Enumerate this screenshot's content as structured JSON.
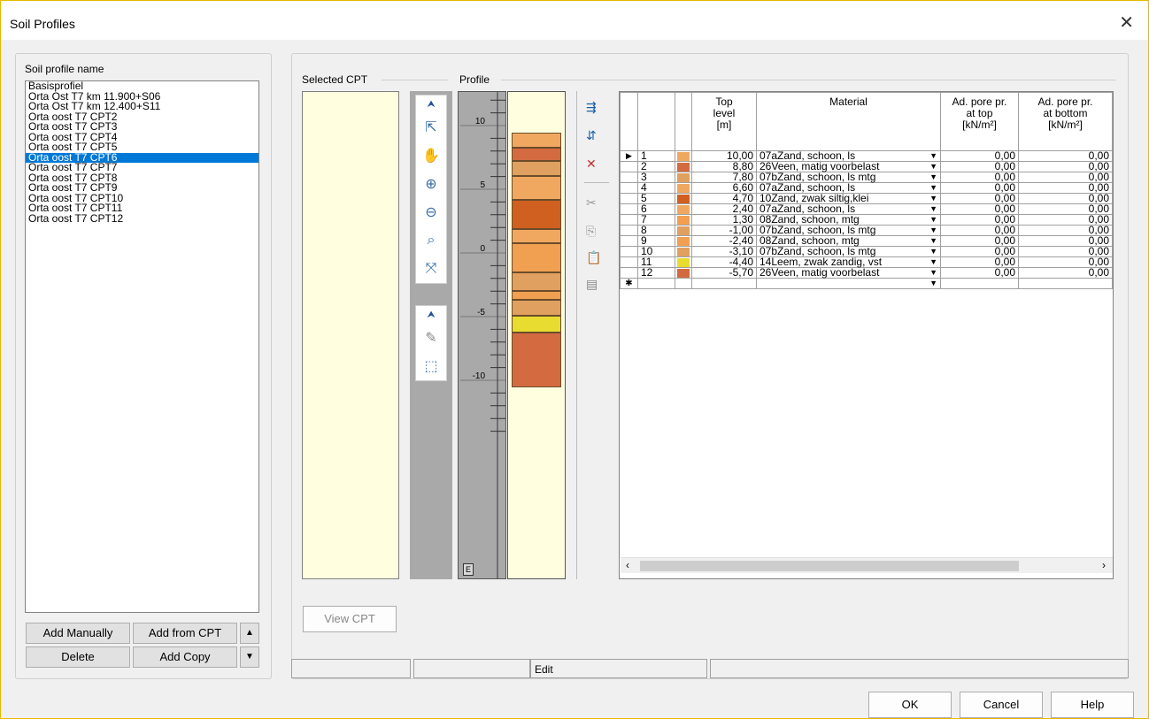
{
  "window": {
    "title": "Soil Profiles",
    "close_glyph": "✕"
  },
  "left_panel": {
    "group_label": "Soil profile name",
    "profiles": [
      "Basisprofiel",
      "Orta Ost T7 km 11.900+S06",
      "Orta Ost T7 km 12.400+S11",
      "Orta oost T7 CPT2",
      "Orta oost T7 CPT3",
      "Orta oost T7 CPT4",
      "Orta oost T7 CPT5",
      "Orta oost T7 CPT6",
      "Orta oost T7 CPT7",
      "Orta oost T7 CPT8",
      "Orta oost T7 CPT9",
      "Orta oost T7 CPT10",
      "Orta oost T7 CPT11",
      "Orta oost T7 CPT12"
    ],
    "selected_index": 7,
    "buttons": {
      "add_manually": "Add Manually",
      "add_from_cpt": "Add from CPT",
      "delete": "Delete",
      "add_copy": "Add Copy",
      "up_glyph": "▲",
      "down_glyph": "▼"
    }
  },
  "right_panel": {
    "selected_cpt_label": "Selected CPT",
    "profile_label": "Profile",
    "view_cpt_button": "View CPT",
    "ruler_ticks": [
      "10",
      "5",
      "0",
      "-5",
      "-10"
    ],
    "ruler_corner": "E",
    "status_text": "Edit"
  },
  "grid": {
    "headers": {
      "top_level": [
        "Top",
        "level",
        "[m]"
      ],
      "material": "Material",
      "pore_top": [
        "Ad. pore pr.",
        "at top",
        "[kN/m²]"
      ],
      "pore_bottom": [
        "Ad. pore pr.",
        "at bottom",
        "[kN/m²]"
      ]
    },
    "rows": [
      {
        "no": "1",
        "color": "#f0a860",
        "top": "10,00",
        "material": "07aZand, schoon, ls",
        "pt": "0,00",
        "pb": "0,00"
      },
      {
        "no": "2",
        "color": "#d46a40",
        "top": "8,80",
        "material": "26Veen, matig voorbelast",
        "pt": "0,00",
        "pb": "0,00"
      },
      {
        "no": "3",
        "color": "#e0a060",
        "top": "7,80",
        "material": "07bZand, schoon, ls mtg",
        "pt": "0,00",
        "pb": "0,00"
      },
      {
        "no": "4",
        "color": "#f0a860",
        "top": "6,60",
        "material": "07aZand, schoon, ls",
        "pt": "0,00",
        "pb": "0,00"
      },
      {
        "no": "5",
        "color": "#d06020",
        "top": "4,70",
        "material": "10Zand, zwak siltig,klei",
        "pt": "0,00",
        "pb": "0,00"
      },
      {
        "no": "6",
        "color": "#f0a860",
        "top": "2,40",
        "material": "07aZand, schoon, ls",
        "pt": "0,00",
        "pb": "0,00"
      },
      {
        "no": "7",
        "color": "#f0a050",
        "top": "1,30",
        "material": "08Zand, schoon, mtg",
        "pt": "0,00",
        "pb": "0,00"
      },
      {
        "no": "8",
        "color": "#e0a060",
        "top": "-1,00",
        "material": "07bZand, schoon, ls mtg",
        "pt": "0,00",
        "pb": "0,00"
      },
      {
        "no": "9",
        "color": "#f0a050",
        "top": "-2,40",
        "material": "08Zand, schoon, mtg",
        "pt": "0,00",
        "pb": "0,00"
      },
      {
        "no": "10",
        "color": "#e0a060",
        "top": "-3,10",
        "material": "07bZand, schoon, ls mtg",
        "pt": "0,00",
        "pb": "0,00"
      },
      {
        "no": "11",
        "color": "#e8dc30",
        "top": "-4,40",
        "material": "14Leem, zwak zandig, vst",
        "pt": "0,00",
        "pb": "0,00"
      },
      {
        "no": "12",
        "color": "#d46a40",
        "top": "-5,70",
        "material": "26Veen, matig voorbelast",
        "pt": "0,00",
        "pb": "0,00"
      }
    ],
    "new_row_glyph": "✱",
    "current_row_glyph": "▶"
  },
  "footer": {
    "ok": "OK",
    "cancel": "Cancel",
    "help": "Help"
  }
}
